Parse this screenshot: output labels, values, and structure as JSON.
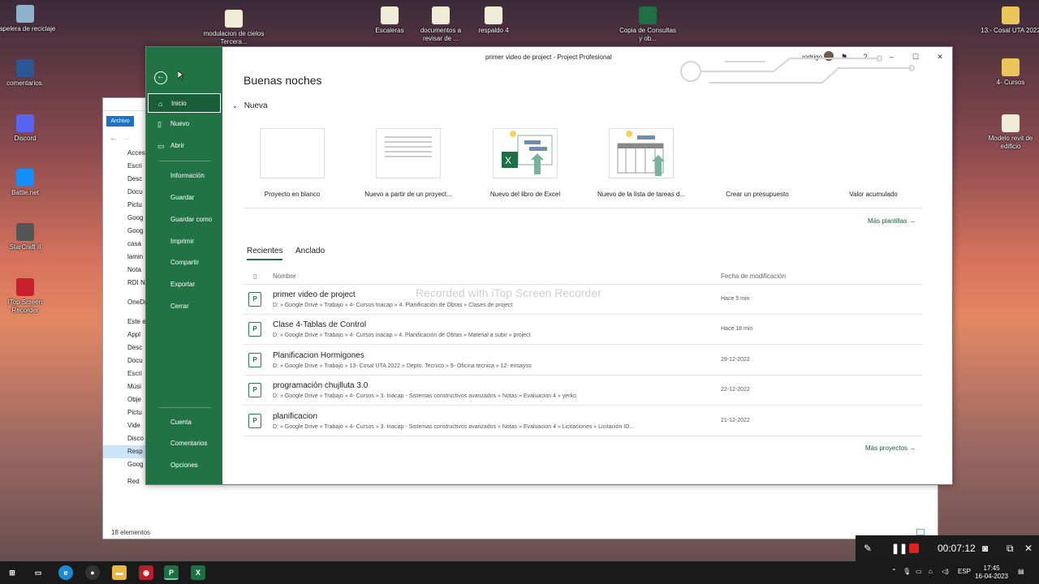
{
  "desktop": {
    "icons": [
      {
        "label": "Papelera de reciclaje",
        "icon": "recycle-bin-icon"
      },
      {
        "label": "comentarios.",
        "icon": "word-icon"
      },
      {
        "label": "Discord",
        "icon": "discord-icon"
      },
      {
        "label": "Battle.net",
        "icon": "battlenet-icon"
      },
      {
        "label": "StarCraft II",
        "icon": "starcraft-icon"
      },
      {
        "label": "iTop Screen Recorder",
        "icon": "recorder-icon"
      },
      {
        "label": "modulacion de cielos Tercera...",
        "icon": "file-icon"
      },
      {
        "label": "Escaleras",
        "icon": "file-icon"
      },
      {
        "label": "documentos a revisar de ...",
        "icon": "file-icon"
      },
      {
        "label": "respaldo 4",
        "icon": "file-icon"
      },
      {
        "label": "Copia de Consultas y ob...",
        "icon": "excel-icon"
      },
      {
        "label": "13.- Cosal UTA 2022",
        "icon": "folder-icon"
      },
      {
        "label": "4- Cursos",
        "icon": "folder-icon"
      },
      {
        "label": "Modelo revit de edificio",
        "icon": "file-icon"
      }
    ]
  },
  "explorer": {
    "archivo_tab": "Archivo",
    "tree": [
      "Acceso",
      "Escri",
      "Desc",
      "Docu",
      "Pictu",
      "Goog",
      "Goog",
      "casa",
      "lamin",
      "Nota",
      "RDI N",
      "OneDr",
      "Este eq",
      "Appl",
      "Desc",
      "Docu",
      "Escri",
      "Músi",
      "Obje",
      "Pictu",
      "Vide",
      "Disco",
      "Resp",
      "Goog",
      "Red"
    ],
    "status": "18 elementos"
  },
  "project": {
    "window_title": "primer video de project  -  Project Profesional",
    "user_name": "rodrigo",
    "sidebar": {
      "top_items": [
        "Inicio",
        "Nuevo",
        "Abrir"
      ],
      "middle_items": [
        "Información",
        "Guardar",
        "Guardar como",
        "Imprimir",
        "Compartir",
        "Exportar",
        "Cerrar"
      ],
      "bottom_items": [
        "Cuenta",
        "Comentarios",
        "Opciones"
      ]
    },
    "greeting": "Buenas noches",
    "new_section": "Nueva",
    "templates": [
      "Proyecto en blanco",
      "Nuevo a partir de un proyect...",
      "Nuevo del libro de Excel",
      "Nuevo de la lista de tareas d...",
      "Crear un presupuesto",
      "Valor acumulado"
    ],
    "more_templates": "Más plantillas",
    "tabs": [
      "Recientes",
      "Anclado"
    ],
    "columns": {
      "name": "Nombre",
      "date": "Fecha de modificación"
    },
    "recent": [
      {
        "name": "primer video de project",
        "path": "D: » Google Drive » Trabajo » 4- Cursos Inacap » 4. Planificación de Obras » Clases de project",
        "date": "Hace 5 min"
      },
      {
        "name": "Clase 4-Tablas de Control",
        "path": "D: » Google Drive » Trabajo » 4- Cursos inacap » 4. Planificación de Obras » Material a subir » project",
        "date": "Hace 18 min"
      },
      {
        "name": "Planificacion Hormigones",
        "path": "D: » Google Drive » Trabajo » 13- Cosal UTA 2022 » Depto. Tecnico » 9- Oficina tecnica » 12- ensayos",
        "date": "29-12-2022"
      },
      {
        "name": "programación chujlluta 3.0",
        "path": "D: » Google Drive » Trabajo » 4- Cursos » 3. Inacap - Sistemas constructivos avanzados » Notas » Evaluacion 4 » yerko",
        "date": "22-12-2022"
      },
      {
        "name": "planificacion",
        "path": "D: » Google Drive » Trabajo » 4- Cursos » 3. Inacap - Sistemas constructivos avanzados » Notas » Evaluacion 4 » Licitaciones » Licitación ID...",
        "date": "21-12-2022"
      }
    ],
    "more_projects": "Más proyectos",
    "watermark": "Recorded with iTop Screen Recorder"
  },
  "recorder": {
    "time": "00:07:12"
  },
  "taskbar": {
    "lang": "ESP",
    "time": "17:45",
    "date": "16-04-2023"
  }
}
